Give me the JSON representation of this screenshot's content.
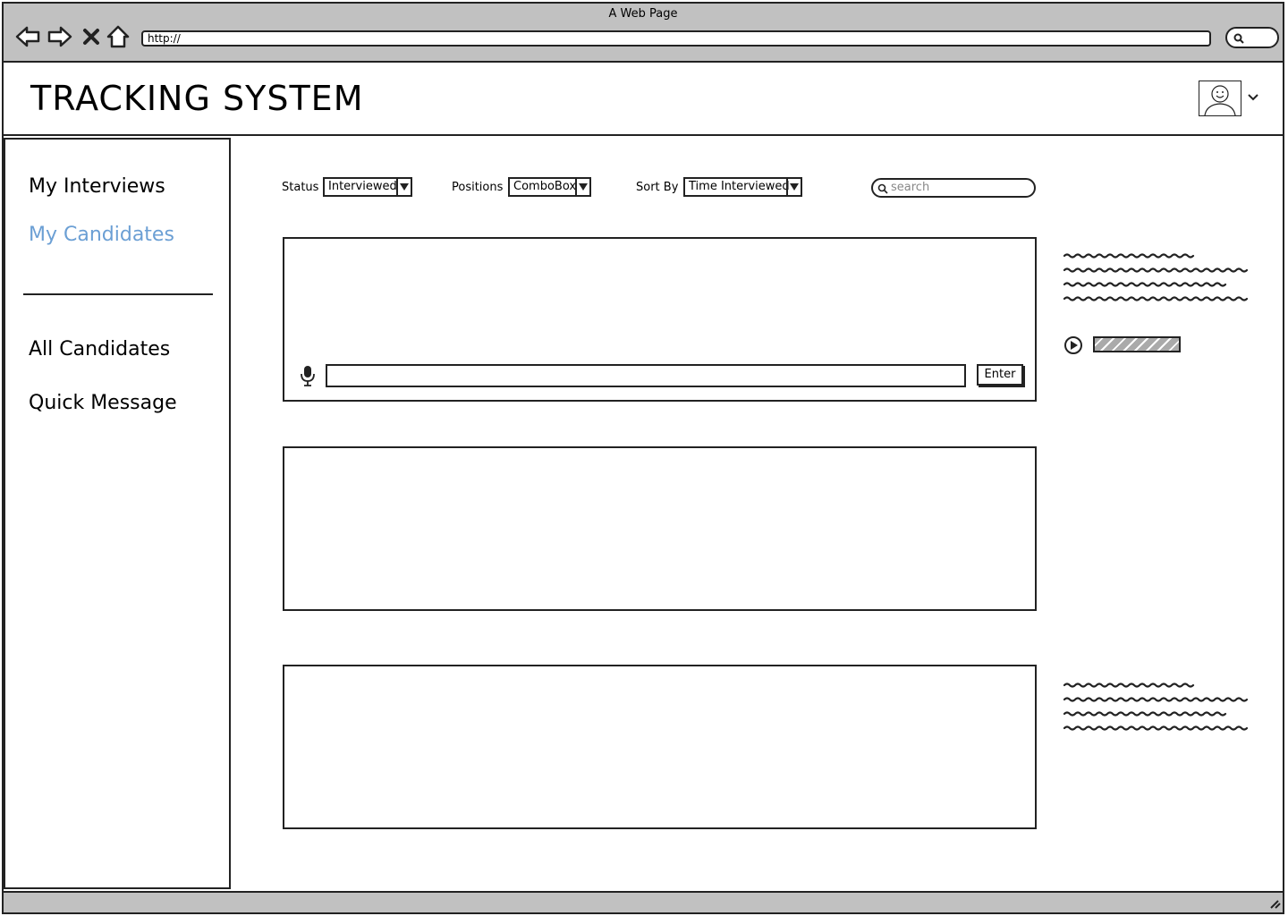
{
  "browser": {
    "window_title": "A Web Page",
    "url": "http://"
  },
  "app": {
    "title": "TRACKING SYSTEM"
  },
  "sidebar": {
    "items": [
      {
        "label": "My Interviews",
        "active": false
      },
      {
        "label": "My Candidates",
        "active": true
      },
      {
        "label": "All Candidates",
        "active": false
      },
      {
        "label": "Quick Message",
        "active": false
      }
    ]
  },
  "filters": {
    "status": {
      "label": "Status",
      "value": "Interviewed"
    },
    "positions": {
      "label": "Positions",
      "value": "ComboBox"
    },
    "sort_by": {
      "label": "Sort By",
      "value": "Time Interviewed"
    },
    "search": {
      "placeholder": "search"
    }
  },
  "panel1": {
    "enter_label": "Enter",
    "input_value": ""
  },
  "media": {
    "progress": 1.0
  },
  "colors": {
    "active_nav": "#6b9fd4",
    "chrome_gray": "#c1c1c1",
    "border": "#222222"
  }
}
